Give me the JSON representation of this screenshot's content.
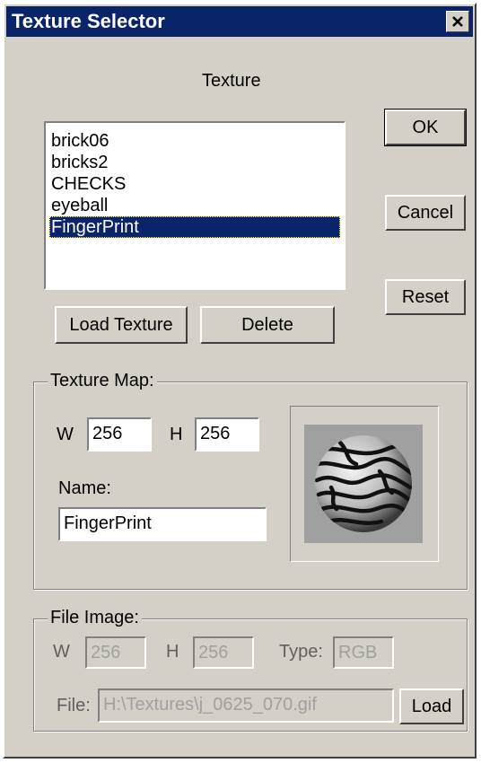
{
  "window": {
    "title": "Texture Selector",
    "close_glyph": "✕"
  },
  "texture_section": {
    "label": "Texture",
    "items": [
      "brick06",
      "bricks2",
      "CHECKS",
      "eyeball",
      "FingerPrint"
    ],
    "selected": "FingerPrint"
  },
  "buttons": {
    "ok": "OK",
    "cancel": "Cancel",
    "reset": "Reset",
    "load_texture": "Load Texture",
    "delete": "Delete",
    "load": "Load"
  },
  "texture_map": {
    "title": "Texture Map:",
    "w_label": "W",
    "w_value": "256",
    "h_label": "H",
    "h_value": "256",
    "name_label": "Name:",
    "name_value": "FingerPrint",
    "preview_icon": "fingerprint-sphere-icon"
  },
  "file_image": {
    "title": "File Image:",
    "w_label": "W",
    "w_value": "256",
    "h_label": "H",
    "h_value": "256",
    "type_label": "Type:",
    "type_value": "RGB",
    "file_label": "File:",
    "file_value": "H:\\Textures\\j_0625_070.gif"
  },
  "colors": {
    "title_bar": "#0a246a",
    "dialog_face": "#d4d0c8",
    "selection": "#0a246a"
  }
}
